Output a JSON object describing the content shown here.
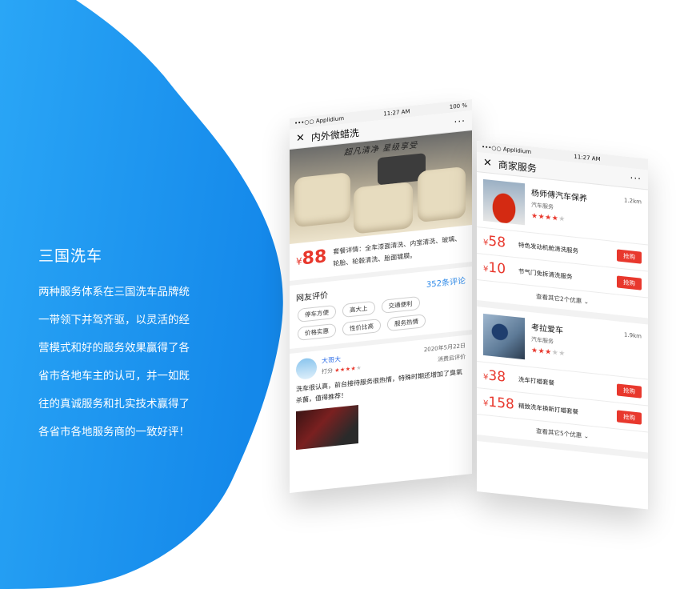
{
  "promo": {
    "title": "三国洗车",
    "body": "两种服务体系在三国洗车品牌统一带领下并驾齐驱，以灵活的经营模式和好的服务效果赢得了各省市各地车主的认可，并一如既往的真诚服务和扎实技术赢得了各省市各地服务商的一致好评！"
  },
  "colors": {
    "accent_blue": "#1e96f0",
    "price_red": "#e8382d"
  },
  "phone1": {
    "status": {
      "carrier": "•••○○ Applidium",
      "time": "11:27 AM",
      "battery": "100 %"
    },
    "nav": {
      "close_icon": "close-icon",
      "title": "内外微蜡洗",
      "more": "···"
    },
    "hero_caption": "超凡清净  星级享受",
    "deal": {
      "currency": "¥",
      "price": "88",
      "details": "套餐详情：全车漆面清洗、内室清洗、玻璃、轮胎、轮毂清洗、胎面镀膜。"
    },
    "reviews": {
      "heading": "网友评价",
      "count": "352条评论",
      "tags": [
        "停车方便",
        "高大上",
        "交通便利",
        "价格实惠",
        "性价比高",
        "服务热情"
      ]
    },
    "review": {
      "name": "大哥大",
      "date": "2020年5月22日",
      "score_label": "打分",
      "rating": 4,
      "type": "消费后评价",
      "text": "洗车很认真，前台接待服务很热情，特殊时期还增加了臭氧杀菌，值得推荐！"
    }
  },
  "phone2": {
    "status": {
      "carrier": "•••○○ Applidium",
      "time": "11:27 AM"
    },
    "nav": {
      "close_icon": "close-icon",
      "title": "商家服务",
      "more": "···"
    },
    "shops": [
      {
        "name": "杨师傅汽车保养",
        "category": "汽车服务",
        "distance": "1.2km",
        "rating": 4,
        "icon": "red-car-photo",
        "offers": [
          {
            "currency": "¥",
            "price": "58",
            "name": "特色发动机舱清洗服务",
            "button": "抢购"
          },
          {
            "currency": "¥",
            "price": "10",
            "name": "节气门免拆清洗服务",
            "button": "抢购"
          }
        ],
        "more": "查看其它2个优惠"
      },
      {
        "name": "考拉爱车",
        "category": "汽车服务",
        "distance": "1.9km",
        "rating": 3,
        "icon": "car-wash-photo",
        "offers": [
          {
            "currency": "¥",
            "price": "38",
            "name": "洗车打蜡套餐",
            "button": "抢购"
          },
          {
            "currency": "¥",
            "price": "158",
            "name": "精致洗车换新打蜡套餐",
            "button": "抢购"
          }
        ],
        "more": "查看其它5个优惠"
      }
    ]
  }
}
